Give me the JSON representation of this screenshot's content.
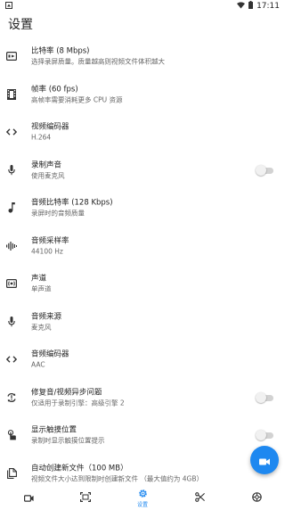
{
  "status_bar": {
    "time": "17:11"
  },
  "page": {
    "title": "设置"
  },
  "settings": [
    {
      "icon": "bitrate-icon",
      "title": "比特率 (8 Mbps)",
      "subtitle": "选择录屏质量。质量越高则视频文件体积越大"
    },
    {
      "icon": "film-frame-icon",
      "title": "帧率 (60 fps)",
      "subtitle": "高帧率需要消耗更多 CPU 资源"
    },
    {
      "icon": "code-icon",
      "title": "视频编码器",
      "subtitle": "H.264"
    },
    {
      "icon": "mic-icon",
      "title": "录制声音",
      "subtitle": "使用麦克风",
      "toggle": false
    },
    {
      "icon": "music-note-icon",
      "title": "音频比特率 (128 Kbps)",
      "subtitle": "录屏时的音频质量"
    },
    {
      "icon": "waveform-icon",
      "title": "音频采样率",
      "subtitle": "44100 Hz"
    },
    {
      "icon": "surround-sound-icon",
      "title": "声道",
      "subtitle": "单声道"
    },
    {
      "icon": "mic-icon",
      "title": "音频来源",
      "subtitle": "麦克风"
    },
    {
      "icon": "code-icon",
      "title": "音频编码器",
      "subtitle": "AAC"
    },
    {
      "icon": "sync-icon",
      "title": "修复音/视频异步问题",
      "subtitle": "仅适用于录制引擎：高级引擎 2",
      "toggle": false
    },
    {
      "icon": "touch-icon",
      "title": "显示触摸位置",
      "subtitle": "录制时显示触摸位置提示",
      "toggle": false
    },
    {
      "icon": "file-copy-icon",
      "title": "自动创建新文件（100 MB）",
      "subtitle": "视频文件大小达到限制时创建新文件 （最大值约为 4GB）"
    }
  ],
  "bottom_nav": {
    "items": [
      {
        "icon": "videocam-icon",
        "label": ""
      },
      {
        "icon": "screenshot-icon",
        "label": ""
      },
      {
        "icon": "settings-gear-icon",
        "label": "设置",
        "active": true
      },
      {
        "icon": "scissors-icon",
        "label": ""
      },
      {
        "icon": "tools-icon",
        "label": ""
      }
    ]
  },
  "colors": {
    "accent": "#1e88f0",
    "icon": "#333333",
    "subtitle": "#666666"
  }
}
